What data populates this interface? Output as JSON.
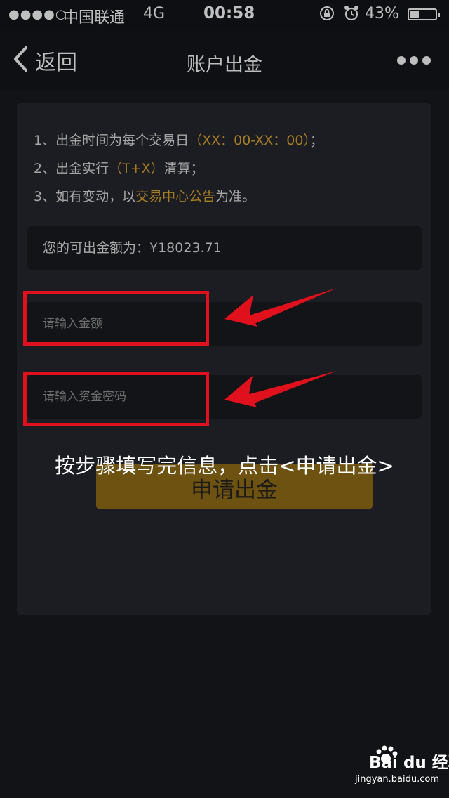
{
  "status_bar": {
    "signal": "●●●●○",
    "carrier": "中国联通",
    "network": "4G",
    "time": "00:58",
    "battery_percent": "43%",
    "battery_level": 0.43
  },
  "nav": {
    "back_label": "返回",
    "title": "账户出金"
  },
  "notes": {
    "line1_prefix": "1、出金时间为每个交易日",
    "line1_highlight": "（XX：00-XX：00）",
    "line1_suffix": "；",
    "line2_prefix": "2、出金实行",
    "line2_highlight": "（T+X）",
    "line2_suffix": "清算；",
    "line3_prefix": "3、如有变动，以",
    "line3_highlight": "交易中心公告",
    "line3_suffix": "为准。"
  },
  "balance_text": "您的可出金额为：¥18023.71",
  "form": {
    "amount_placeholder": "请输入金额",
    "password_placeholder": "请输入资金密码",
    "submit_label": "申请出金"
  },
  "overlay": {
    "caption": "按步骤填写完信息，点击<申请出金>"
  },
  "watermark": {
    "logo": "Bai du 经验",
    "url": "jingyan.baidu.com"
  },
  "colors": {
    "accent_gold": "#a67d24",
    "button_bg": "#6d5212",
    "highlight_red": "#e0111c"
  }
}
